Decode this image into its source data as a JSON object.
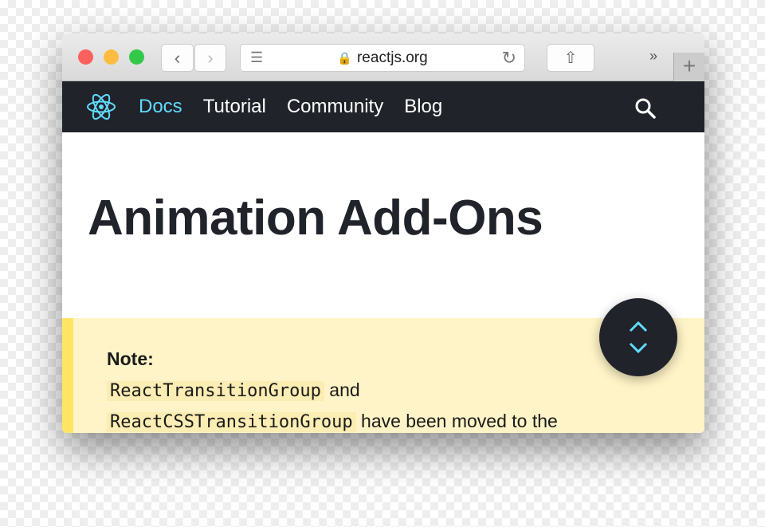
{
  "browser": {
    "url": "reactjs.org",
    "colors": {
      "close": "#fc605c",
      "minimize": "#fdbc40",
      "zoom": "#34c84a"
    }
  },
  "nav": {
    "items": [
      {
        "label": "Docs",
        "active": true
      },
      {
        "label": "Tutorial"
      },
      {
        "label": "Community"
      },
      {
        "label": "Blog"
      }
    ],
    "accent": "#61dafb"
  },
  "page": {
    "title": "Animation Add-Ons"
  },
  "note": {
    "heading": "Note:",
    "code1": "ReactTransitionGroup",
    "text1": " and",
    "code2": "ReactCSSTransitionGroup",
    "text2": " have been moved to the"
  }
}
